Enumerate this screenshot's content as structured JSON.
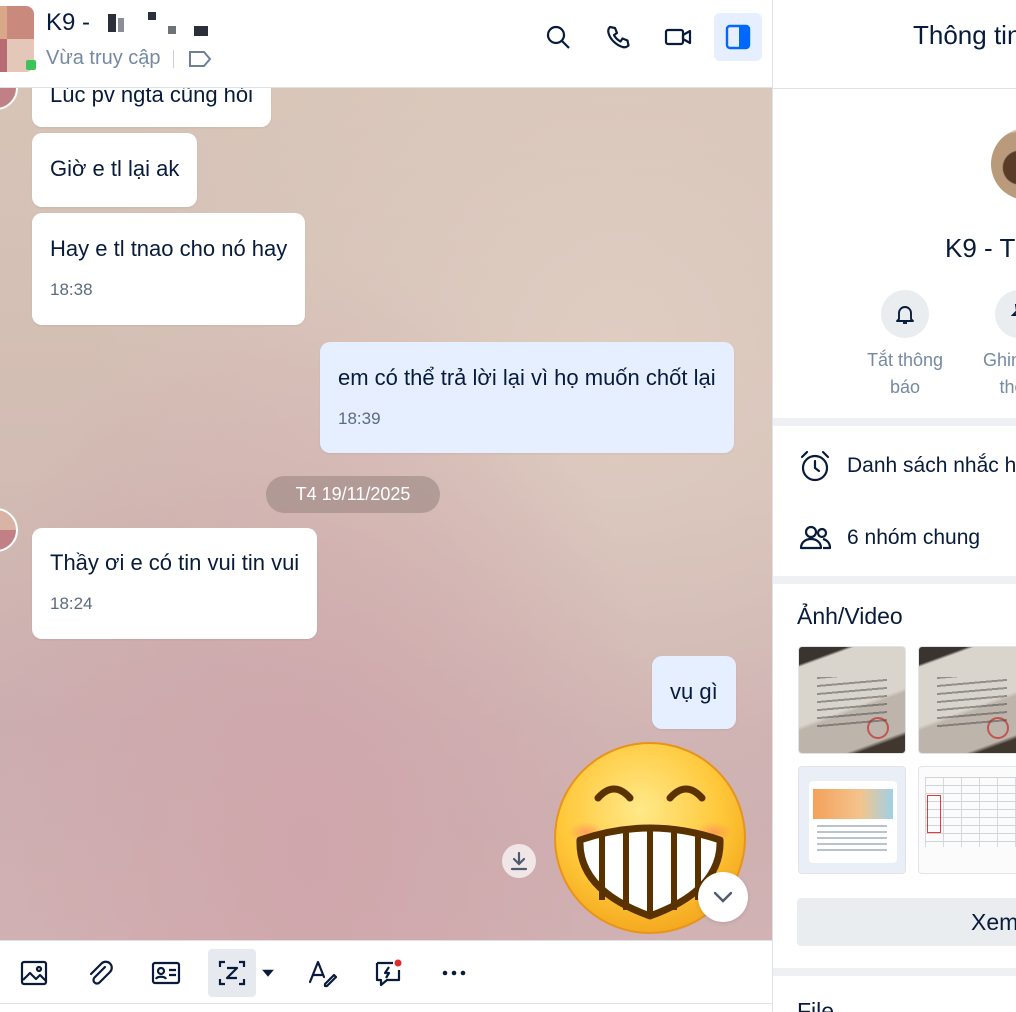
{
  "header": {
    "contact_name": "K9 -",
    "status": "Vừa truy cập",
    "actions": [
      "search-icon",
      "phone-icon",
      "video-call-icon",
      "toggle-info-panel-icon"
    ]
  },
  "messages": [
    {
      "text": "Lúc pv ngta cũng hỏi",
      "time": "",
      "mine": false
    },
    {
      "text": "Giờ e tl lại ak",
      "time": "",
      "mine": false
    },
    {
      "text": "Hay e tl tnao cho nó hay",
      "time": "18:38",
      "mine": false
    },
    {
      "text": "em có thể trả lời lại vì họ muốn chốt lại",
      "time": "18:39",
      "mine": true
    },
    {
      "text": "Thầy ơi e có tin vui tin vui",
      "time": "18:24",
      "mine": false
    },
    {
      "text": "vụ gì",
      "time": "",
      "mine": true
    }
  ],
  "date_separator": "T4 19/11/2025",
  "sticker": "grinning-face-sticker",
  "toolbar": {
    "items": [
      "image-icon",
      "attachment-icon",
      "contact-card-icon",
      "screenshot-icon",
      "dropdown-caret-icon",
      "text-format-icon",
      "quick-message-icon",
      "more-icon"
    ]
  },
  "info_panel": {
    "title": "Thông tin hội thoại",
    "name": "K9 - T",
    "actions": [
      {
        "label_line1": "Tắt thông",
        "label_line2": "báo",
        "icon": "bell-icon"
      },
      {
        "label_line1": "Ghim hội",
        "label_line2": "thoại",
        "icon": "pin-icon"
      }
    ],
    "reminders": "Danh sách nhắc hẹn",
    "common_groups": "6 nhóm chung",
    "media_title": "Ảnh/Video",
    "view_all": "Xem tất cả",
    "file_title": "File"
  },
  "colors": {
    "accent": "#0068ff",
    "my_bubble": "#e5efff",
    "text": "#081b3a",
    "muted": "#7589a3"
  }
}
